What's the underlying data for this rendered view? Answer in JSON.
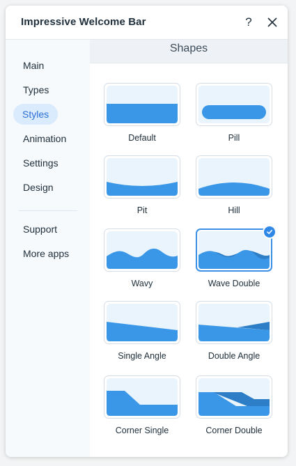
{
  "app": {
    "title": "Impressive Welcome Bar",
    "help_icon": "question-mark-icon",
    "close_icon": "close-icon"
  },
  "sidebar": {
    "items": [
      {
        "label": "Main"
      },
      {
        "label": "Types"
      },
      {
        "label": "Styles",
        "active": true
      },
      {
        "label": "Animation"
      },
      {
        "label": "Settings"
      },
      {
        "label": "Design"
      }
    ],
    "secondary_items": [
      {
        "label": "Support"
      },
      {
        "label": "More apps"
      }
    ]
  },
  "main": {
    "section_title": "Shapes",
    "shapes": [
      {
        "label": "Default"
      },
      {
        "label": "Pill"
      },
      {
        "label": "Pit"
      },
      {
        "label": "Hill"
      },
      {
        "label": "Wavy"
      },
      {
        "label": "Wave Double",
        "selected": true
      },
      {
        "label": "Single Angle"
      },
      {
        "label": "Double Angle"
      },
      {
        "label": "Corner Single"
      },
      {
        "label": "Corner Double"
      }
    ]
  },
  "colors": {
    "accent": "#3b90e6",
    "shape_fill": "#3a97e8",
    "shape_dark": "#2d7ec7",
    "preview_bg": "#eaf4fc",
    "active_nav_bg": "#d9ebfc"
  }
}
